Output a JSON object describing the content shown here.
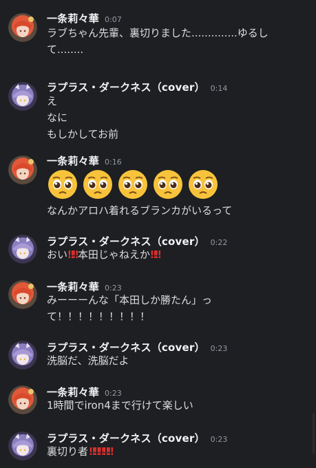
{
  "messages": [
    {
      "author": "一条莉々華",
      "time": "0:07",
      "lines": [
        "ラブちゃん先輩、裏切りました..............ゆるし",
        "て........"
      ]
    },
    {
      "author": "ラプラス・ダークネス（cover）",
      "time": "0:14",
      "lines": [
        "え",
        "なに",
        "もしかしてお前"
      ]
    },
    {
      "author": "一条莉々華",
      "time": "0:16",
      "emoji": [
        "pleading-face",
        "pleading-face",
        "pleading-face",
        "pleading-face",
        "pleading-face"
      ],
      "lines": [
        "なんかアロハ着れるブランカがいるって"
      ]
    },
    {
      "author": "ラプラス・ダークネス（cover）",
      "time": "0:22",
      "parts": [
        "おい",
        "‼‼",
        "本田じゃねえか",
        "‼‼"
      ]
    },
    {
      "author": "一条莉々華",
      "time": "0:23",
      "lines": [
        "みーーーんな「本田しか勝たん」っ",
        "て！！！！！！！！！"
      ]
    },
    {
      "author": "ラプラス・ダークネス（cover）",
      "time": "0:23",
      "lines": [
        "洗脳だ、洗脳だよ"
      ]
    },
    {
      "author": "一条莉々華",
      "time": "0:23",
      "lines": [
        "1時間でiron4まで行けて楽しい"
      ]
    },
    {
      "author": "ラプラス・ダークネス（cover）",
      "time": "0:23",
      "parts": [
        "裏切り者",
        "‼‼‼‼‼"
      ]
    }
  ],
  "colors": {
    "background": "#1e1f22",
    "username": "#f2f3f5",
    "text": "#dbdee1",
    "timestamp": "#949ba4",
    "bang": "#e0302f"
  }
}
